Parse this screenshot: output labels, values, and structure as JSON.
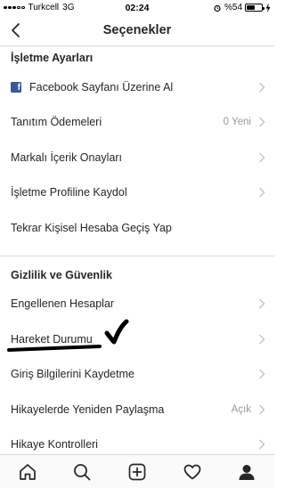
{
  "status_bar": {
    "carrier": "Turkcell",
    "network": "3G",
    "time": "02:24",
    "battery": "%54",
    "battery_level": 0.54
  },
  "nav": {
    "title": "Seçenekler",
    "back_icon": "chevron-left-icon"
  },
  "sections": [
    {
      "header": "İşletme Ayarları",
      "items": [
        {
          "label": "Facebook Sayfanı Üzerine Al",
          "icon": "facebook-icon"
        },
        {
          "label": "Tanıtım Ödemeleri",
          "value": "0 Yeni"
        },
        {
          "label": "Markalı İçerik Onayları"
        },
        {
          "label": "İşletme Profiline Kaydol"
        },
        {
          "label": "Tekrar Kişisel Hesaba Geçiş Yap"
        }
      ]
    },
    {
      "header": "Gizlilik ve Güvenlik",
      "items": [
        {
          "label": "Engellenen Hesaplar"
        },
        {
          "label": "Hareket Durumu"
        },
        {
          "label": "Giriş Bilgilerini Kaydetme"
        },
        {
          "label": "Hikayelerde Yeniden Paylaşma",
          "value": "Açık"
        },
        {
          "label": "Hikaye Kontrolleri"
        }
      ]
    }
  ],
  "tab_bar": {
    "tabs": [
      "home-icon",
      "search-icon",
      "new-post-icon",
      "activity-heart-icon",
      "profile-icon"
    ]
  },
  "colors": {
    "text": "#262626",
    "secondary": "#999999",
    "divider": "#dbdbdb",
    "facebook": "#3b5998",
    "chevron": "#c7c7cc",
    "annotation_ink": "#000000"
  }
}
